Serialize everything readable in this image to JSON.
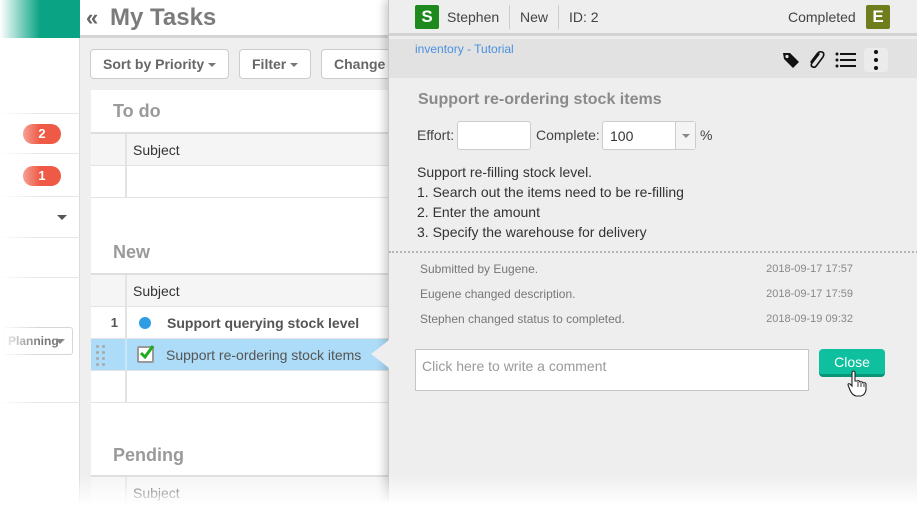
{
  "sidebar": {
    "badges": [
      "2",
      "1"
    ],
    "select_label": "Planning"
  },
  "main": {
    "title": "My Tasks",
    "collapse_glyph": "«",
    "toolbar": {
      "sort_label": "Sort by Priority",
      "filter_label": "Filter",
      "change_label": "Change"
    },
    "groups": {
      "todo": {
        "title": "To do",
        "column": "Subject"
      },
      "new": {
        "title": "New",
        "column": "Subject",
        "rows": [
          {
            "num": "1",
            "subject": "Support querying stock level",
            "status": "new"
          },
          {
            "num": "",
            "subject": "Support re-ordering stock items",
            "status": "completed"
          }
        ]
      },
      "pending": {
        "title": "Pending",
        "column": "Subject"
      }
    }
  },
  "panel": {
    "assignee": {
      "initial": "S",
      "name": "Stephen",
      "color": "#1e8a1e"
    },
    "status": "New",
    "id_label": "ID: 2",
    "state": "Completed",
    "submitter": {
      "initial": "E",
      "color": "#6f7d1c"
    },
    "project_link": "inventory - Tutorial",
    "task_title": "Support re-ordering stock items",
    "effort_label": "Effort:",
    "effort_value": "",
    "complete_label": "Complete:",
    "complete_value": "100",
    "percent_sign": "%",
    "description": [
      "Support re-filling stock level.",
      "1. Search out the items need to be re-filling",
      "2. Enter the amount",
      "3. Specify the warehouse for delivery"
    ],
    "history": [
      {
        "text": "Submitted by Eugene.",
        "time": "2018-09-17 17:57"
      },
      {
        "text": "Eugene changed description.",
        "time": "2018-09-17 17:59"
      },
      {
        "text": "Stephen changed status to completed.",
        "time": "2018-09-19 09:32"
      }
    ],
    "comment_placeholder": "Click here to write a comment",
    "close_label": "Close"
  },
  "colors": {
    "brand": "#0aa384",
    "badge": "#ef5a46",
    "selected_row": "#acdcf7",
    "close_button": "#0ec09e",
    "link": "#4a90e2"
  }
}
